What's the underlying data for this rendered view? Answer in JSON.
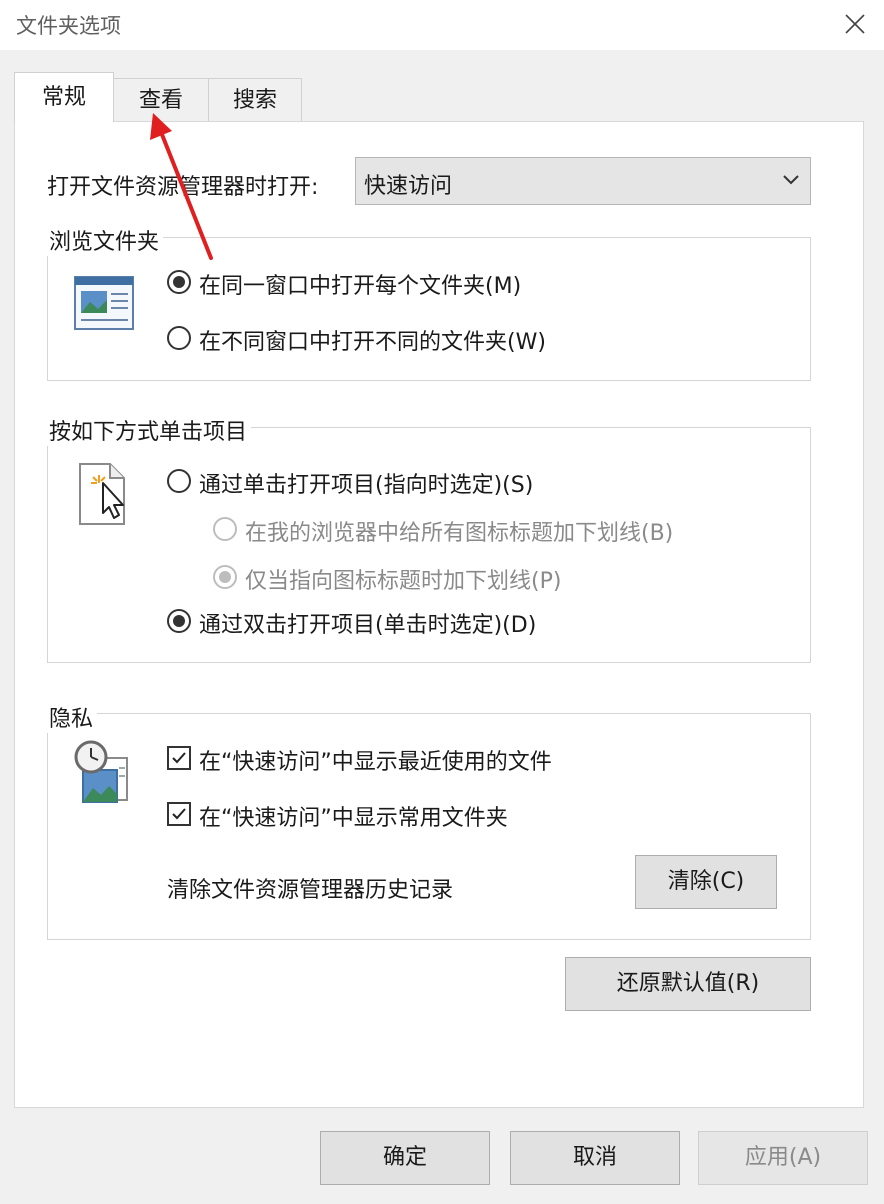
{
  "window": {
    "title": "文件夹选项"
  },
  "tabs": [
    {
      "label": "常规",
      "active": true
    },
    {
      "label": "查看",
      "active": false
    },
    {
      "label": "搜索",
      "active": false
    }
  ],
  "general": {
    "open_explorer_label": "打开文件资源管理器时打开:",
    "open_explorer_value": "快速访问",
    "browse_group": {
      "title": "浏览文件夹",
      "options": [
        {
          "label": "在同一窗口中打开每个文件夹(M)",
          "checked": true
        },
        {
          "label": "在不同窗口中打开不同的文件夹(W)",
          "checked": false
        }
      ]
    },
    "click_group": {
      "title": "按如下方式单击项目",
      "single_click": "通过单击打开项目(指向时选定)(S)",
      "underline_all": "在我的浏览器中给所有图标标题加下划线(B)",
      "underline_point": "仅当指向图标标题时加下划线(P)",
      "double_click": "通过双击打开项目(单击时选定)(D)"
    },
    "privacy_group": {
      "title": "隐私",
      "recent_files": "在“快速访问”中显示最近使用的文件",
      "frequent_folders": "在“快速访问”中显示常用文件夹",
      "clear_history_label": "清除文件资源管理器历史记录",
      "clear_button": "清除(C)"
    },
    "restore_defaults": "还原默认值(R)"
  },
  "footer": {
    "ok": "确定",
    "cancel": "取消",
    "apply": "应用(A)"
  },
  "annotation": {
    "arrow_color": "#e02020"
  }
}
